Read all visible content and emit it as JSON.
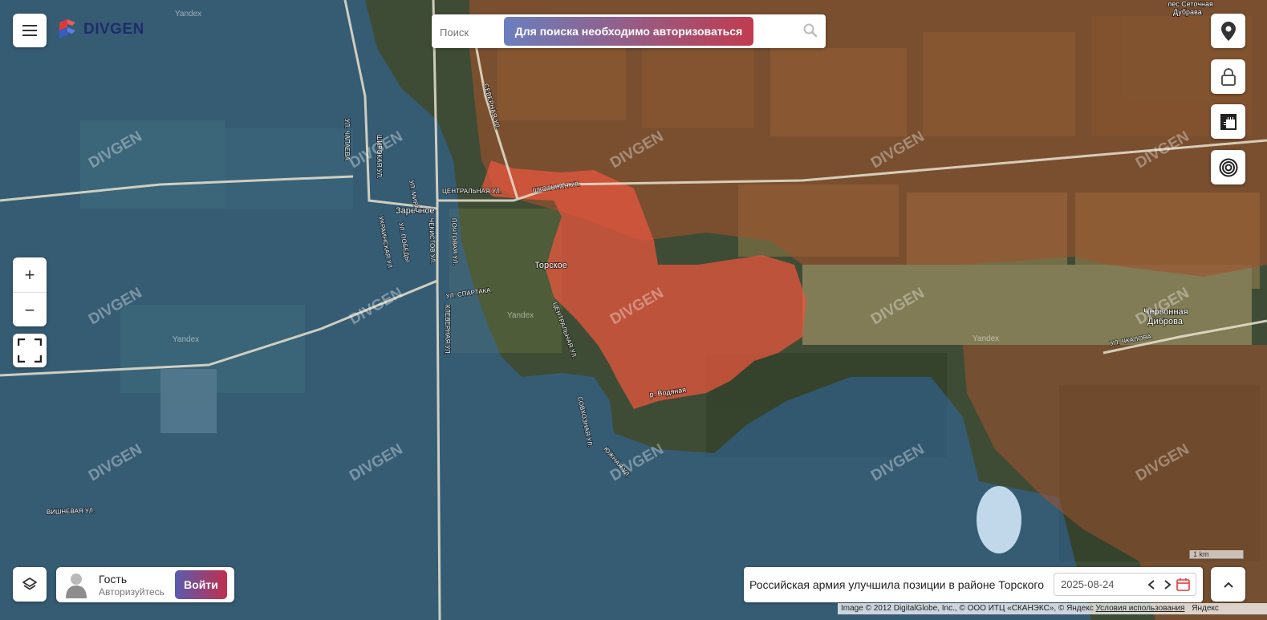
{
  "brand": {
    "name": "DIVGEN"
  },
  "search": {
    "placeholder": "Поиск",
    "auth_notice": "Для поиска необходимо авторизоваться"
  },
  "map": {
    "places": {
      "zarechnoe": "Заречное",
      "torskoe": "Торское",
      "chernovaya_dibrova": "Червонная\nДиброва",
      "les_setochnaya": "лес Сеточная\nДубрава"
    },
    "streets": {
      "centralnaya_1": "ЦЕНТРАЛЬНАЯ УЛ.",
      "shkolnaya": "ШКОЛЬНАЯ УЛ.",
      "severnaya": "СЕВЕРНАЯ УЛ.",
      "shirokaya": "ШИРОКАЯ УЛ.",
      "chapaeva": "УЛ. ЧАПАЕВА",
      "mira": "УЛ. МИРА",
      "pobedy": "УЛ. ПОБЕДЫ",
      "ukrainskaya": "УКРАИНСКАЯ УЛ.",
      "chekistov": "ЧЕКИСТОВ УЛ.",
      "pochtovaya": "ПОЧТОВАЯ УЛ.",
      "spartaka": "УЛ. СПАРТАКА",
      "krupskoy": "КЛЕВЕРНАЯ УЛ.",
      "centralnaya_2": "ЦЕНТРАЛЬНАЯ УЛ.",
      "sovkhoznaya": "СОВХОЗНАЯ УЛ.",
      "yuzhnaya": "ЮЖНАЯ УЛ.",
      "vishnevaya": "ВИШНЁВАЯ УЛ.",
      "chkalova": "УЛ. ЧКАЛОВА"
    },
    "river": "р. Водяная",
    "watermark": "DIVGEN",
    "provider_watermark": "Yandex",
    "zones": {
      "russian_control": "#a0522d",
      "ukrainian_control": "#2f6aa8",
      "contested_advance": "#e8553d"
    }
  },
  "controls": {
    "menu_icon": "hamburger-icon",
    "location_icon": "location-pin-icon",
    "lock_icon": "lock-icon",
    "ruler_icon": "ruler-icon",
    "target_icon": "target-icon",
    "zoom_in": "+",
    "zoom_out": "−",
    "layers_icon": "layers-icon",
    "collapse_icon": "chevron-up-icon"
  },
  "user": {
    "name": "Гость",
    "subtitle": "Авторизуйтесь",
    "login_label": "Войти"
  },
  "news": {
    "title": "Российская армия улучшила позиции в районе Торского",
    "date": "2025-08-24"
  },
  "scale": {
    "label": "1 km"
  },
  "attribution": {
    "text": "Image © 2012 DigitalGlobe, Inc., © ООО ИТЦ «СКАНЭКС», © Яндекс ",
    "terms": "Условия использования",
    "brand": "Яндекс"
  }
}
